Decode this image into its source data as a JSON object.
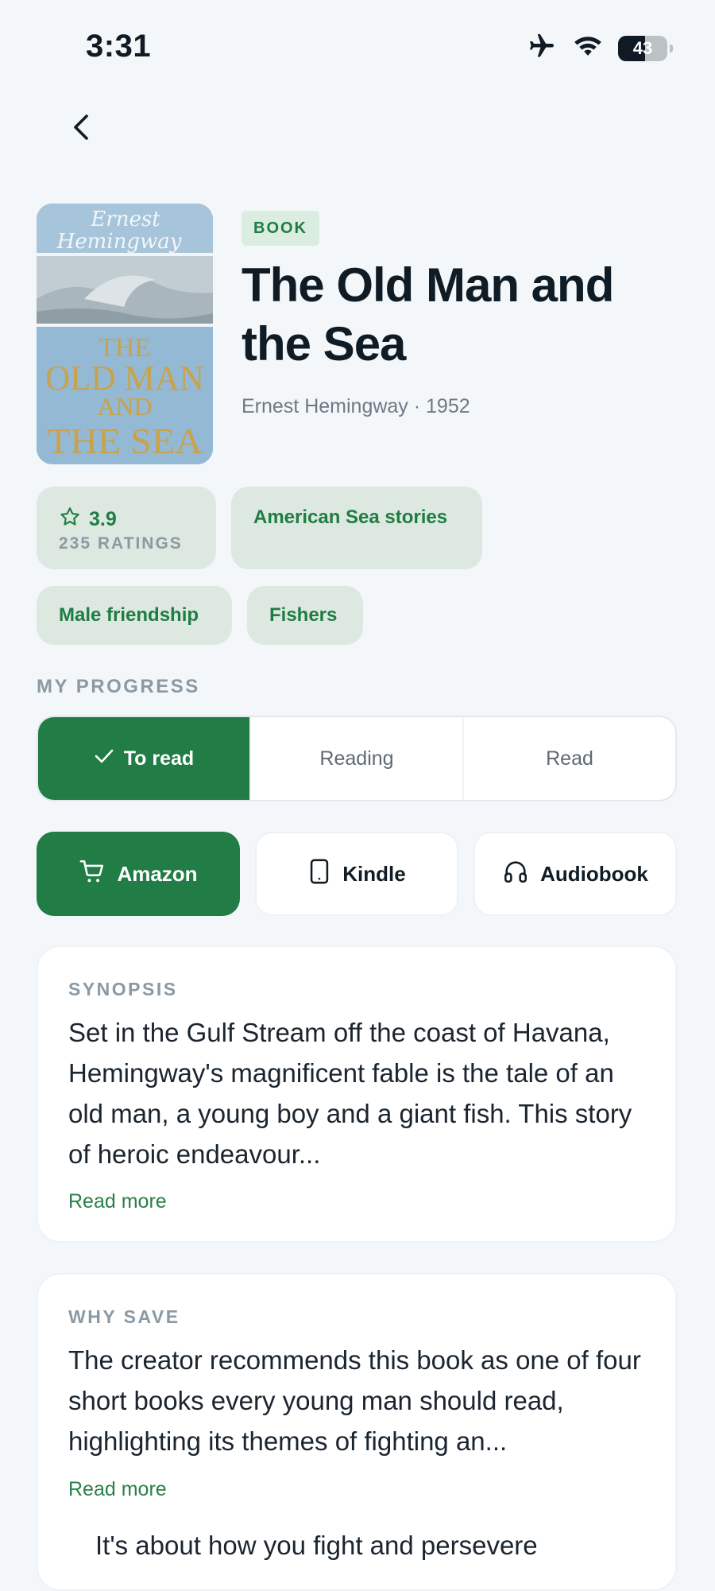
{
  "status_bar": {
    "time": "3:31",
    "battery": "43"
  },
  "book": {
    "type_badge": "BOOK",
    "title": "The Old Man and the Sea",
    "author_year": "Ernest Hemingway · 1952",
    "cover": {
      "author_script_1": "Ernest",
      "author_script_2": "Hemingway",
      "title_lines": [
        "THE",
        "OLD MAN",
        "AND",
        "THE SEA"
      ]
    }
  },
  "rating": {
    "value": "3.9",
    "count_label": "235 RATINGS"
  },
  "tags": [
    "American Sea stories",
    "Male friendship",
    "Fishers"
  ],
  "progress": {
    "label": "MY PROGRESS",
    "options": [
      "To read",
      "Reading",
      "Read"
    ],
    "selected": "To read"
  },
  "buy_buttons": [
    {
      "label": "Amazon",
      "icon": "cart-icon"
    },
    {
      "label": "Kindle",
      "icon": "tablet-icon"
    },
    {
      "label": "Audiobook",
      "icon": "headphones-icon"
    }
  ],
  "synopsis": {
    "label": "SYNOPSIS",
    "text": "Set in the Gulf Stream off the coast of Havana, Hemingway's magnificent fable is the tale of an old man, a young boy and a giant fish. This story of heroic endeavour...",
    "read_more": "Read more"
  },
  "why_save": {
    "label": "WHY SAVE",
    "text": "The creator recommends this book as one of four short books every young man should read, highlighting its themes of fighting an...",
    "read_more": "Read more",
    "extra_partial": "It's about how you fight and persevere"
  },
  "colors": {
    "accent": "#217c45",
    "background": "#f4f7f9",
    "chip_bg": "#dde8e1"
  }
}
